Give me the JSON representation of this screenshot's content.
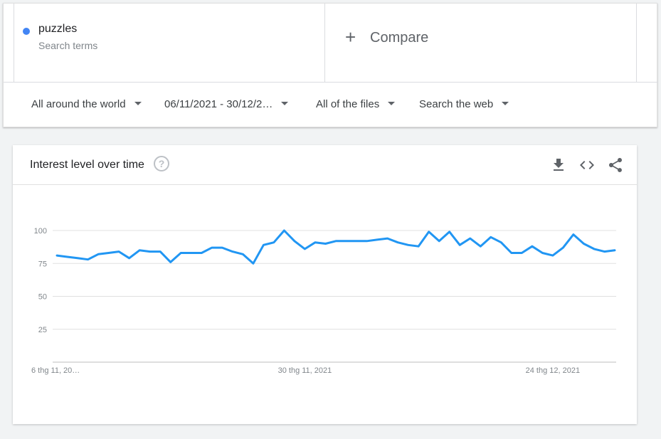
{
  "search_term": {
    "name": "puzzles",
    "subtitle": "Search terms",
    "dot_color": "#4285f4"
  },
  "compare": {
    "plus": "+",
    "label": "Compare"
  },
  "filters": {
    "region": "All around the world",
    "date_range": "06/11/2021 - 30/12/2…",
    "category": "All of the files",
    "search_type": "Search the web"
  },
  "chart_card": {
    "title": "Interest level over time",
    "help": "?",
    "icons": [
      "download-icon",
      "embed-code-icon",
      "share-icon"
    ]
  },
  "chart_data": {
    "type": "line",
    "title": "Interest level over time",
    "ylim": [
      0,
      100
    ],
    "yticks": [
      25,
      50,
      75,
      100
    ],
    "ytick_labels": [
      "25",
      "50",
      "75",
      "100"
    ],
    "xtick_labels": [
      "6 thg 11, 20…",
      "30 thg 11, 2021",
      "24 thg 12, 2021"
    ],
    "x_start": "2021-11-06",
    "x_end": "2021-12-30",
    "xtick_dates": [
      "2021-11-06",
      "2021-11-30",
      "2021-12-24"
    ],
    "grid": true,
    "line_color": "#2196f3",
    "series": [
      {
        "name": "puzzles",
        "x": [
          "2021-11-06",
          "2021-11-07",
          "2021-11-08",
          "2021-11-09",
          "2021-11-10",
          "2021-11-11",
          "2021-11-12",
          "2021-11-13",
          "2021-11-14",
          "2021-11-15",
          "2021-11-16",
          "2021-11-17",
          "2021-11-18",
          "2021-11-19",
          "2021-11-20",
          "2021-11-21",
          "2021-11-22",
          "2021-11-23",
          "2021-11-24",
          "2021-11-25",
          "2021-11-26",
          "2021-11-27",
          "2021-11-28",
          "2021-11-29",
          "2021-11-30",
          "2021-12-01",
          "2021-12-02",
          "2021-12-03",
          "2021-12-04",
          "2021-12-05",
          "2021-12-06",
          "2021-12-07",
          "2021-12-08",
          "2021-12-09",
          "2021-12-10",
          "2021-12-11",
          "2021-12-12",
          "2021-12-13",
          "2021-12-14",
          "2021-12-15",
          "2021-12-16",
          "2021-12-17",
          "2021-12-18",
          "2021-12-19",
          "2021-12-20",
          "2021-12-21",
          "2021-12-22",
          "2021-12-23",
          "2021-12-24",
          "2021-12-25",
          "2021-12-26",
          "2021-12-27",
          "2021-12-28",
          "2021-12-29",
          "2021-12-30"
        ],
        "values": [
          81,
          80,
          79,
          78,
          82,
          83,
          84,
          79,
          85,
          84,
          84,
          76,
          83,
          83,
          83,
          87,
          87,
          84,
          82,
          75,
          89,
          91,
          100,
          92,
          86,
          91,
          90,
          92,
          92,
          92,
          92,
          93,
          94,
          91,
          89,
          88,
          99,
          92,
          99,
          89,
          94,
          88,
          95,
          91,
          83,
          83,
          88,
          83,
          81,
          87,
          97,
          90,
          86,
          84,
          85
        ]
      }
    ]
  }
}
